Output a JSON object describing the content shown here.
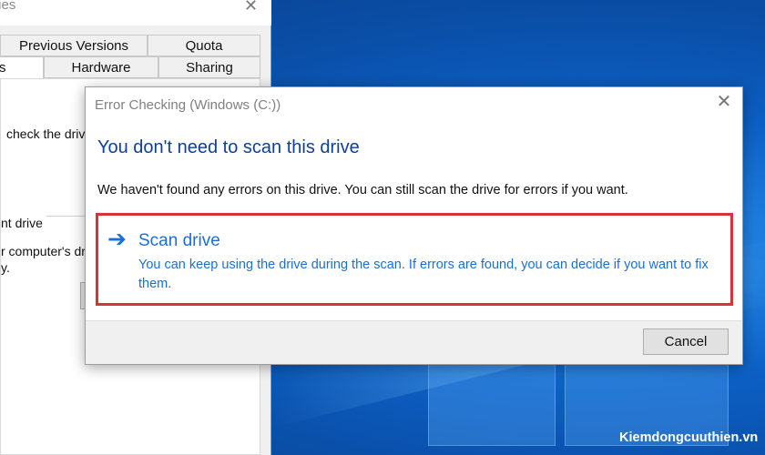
{
  "background_window": {
    "title": "ties",
    "tabs": [
      {
        "label": "Previous Versions"
      },
      {
        "label": "Quota"
      },
      {
        "label": "s"
      },
      {
        "label": "Hardware"
      },
      {
        "label": "Sharing"
      }
    ],
    "body_lines": [
      "check the driv",
      "nt drive",
      "r computer's dr",
      "y."
    ]
  },
  "dialog": {
    "title": "Error Checking (Windows (C:))",
    "heading": "You don't need to scan this drive",
    "message": "We haven't found any errors on this drive. You can still scan the drive for errors if you want.",
    "command_link": {
      "title": "Scan drive",
      "description": "You can keep using the drive during the scan. If errors are found, you can decide if you want to fix them."
    },
    "cancel_label": "Cancel"
  },
  "watermark": "Kiemdongcuuthien.vn",
  "colors": {
    "accent_link": "#1a6fd6",
    "heading": "#0d3f9f",
    "highlight_border": "#d8333b"
  }
}
